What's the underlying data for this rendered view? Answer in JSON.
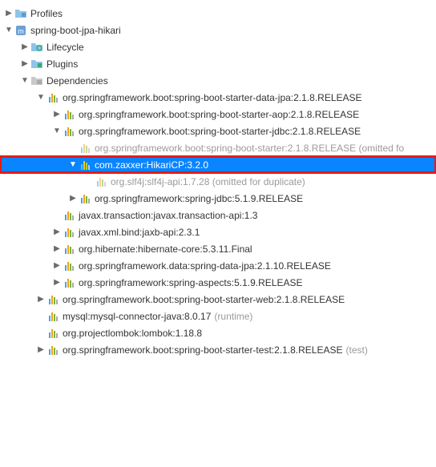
{
  "tree": [
    {
      "id": "profiles",
      "indent": 0,
      "arrow": "right",
      "icon": "folder-profiles",
      "label": "Profiles"
    },
    {
      "id": "project",
      "indent": 0,
      "arrow": "down",
      "icon": "maven",
      "label": "spring-boot-jpa-hikari"
    },
    {
      "id": "lifecycle",
      "indent": 1,
      "arrow": "right",
      "icon": "folder-lifecycle",
      "label": "Lifecycle"
    },
    {
      "id": "plugins",
      "indent": 1,
      "arrow": "right",
      "icon": "folder-plugins",
      "label": "Plugins"
    },
    {
      "id": "deps",
      "indent": 1,
      "arrow": "down",
      "icon": "folder-deps",
      "label": "Dependencies"
    },
    {
      "id": "d1",
      "indent": 2,
      "arrow": "down",
      "icon": "jar",
      "label": "org.springframework.boot:spring-boot-starter-data-jpa:2.1.8.RELEASE"
    },
    {
      "id": "d1a",
      "indent": 3,
      "arrow": "right",
      "icon": "jar",
      "label": "org.springframework.boot:spring-boot-starter-aop:2.1.8.RELEASE"
    },
    {
      "id": "d1b",
      "indent": 3,
      "arrow": "down",
      "icon": "jar",
      "label": "org.springframework.boot:spring-boot-starter-jdbc:2.1.8.RELEASE"
    },
    {
      "id": "d1b1",
      "indent": 4,
      "arrow": "none",
      "icon": "jar-dim",
      "muted": true,
      "label": "org.springframework.boot:spring-boot-starter:2.1.8.RELEASE (omitted fo"
    },
    {
      "id": "d1b2",
      "indent": 4,
      "arrow": "down",
      "icon": "jar",
      "selected": true,
      "highlighted": true,
      "label": "com.zaxxer:HikariCP:3.2.0"
    },
    {
      "id": "d1b2a",
      "indent": 5,
      "arrow": "none",
      "icon": "jar-dim",
      "muted": true,
      "label": "org.slf4j:slf4j-api:1.7.28 (omitted for duplicate)"
    },
    {
      "id": "d1b3",
      "indent": 4,
      "arrow": "right",
      "icon": "jar",
      "label": "org.springframework:spring-jdbc:5.1.9.RELEASE"
    },
    {
      "id": "d1c",
      "indent": 3,
      "arrow": "none",
      "icon": "jar",
      "label": "javax.transaction:javax.transaction-api:1.3"
    },
    {
      "id": "d1d",
      "indent": 3,
      "arrow": "right",
      "icon": "jar",
      "label": "javax.xml.bind:jaxb-api:2.3.1"
    },
    {
      "id": "d1e",
      "indent": 3,
      "arrow": "right",
      "icon": "jar",
      "label": "org.hibernate:hibernate-core:5.3.11.Final"
    },
    {
      "id": "d1f",
      "indent": 3,
      "arrow": "right",
      "icon": "jar",
      "label": "org.springframework.data:spring-data-jpa:2.1.10.RELEASE"
    },
    {
      "id": "d1g",
      "indent": 3,
      "arrow": "right",
      "icon": "jar",
      "label": "org.springframework:spring-aspects:5.1.9.RELEASE"
    },
    {
      "id": "d2",
      "indent": 2,
      "arrow": "right",
      "icon": "jar",
      "label": "org.springframework.boot:spring-boot-starter-web:2.1.8.RELEASE"
    },
    {
      "id": "d3",
      "indent": 2,
      "arrow": "none",
      "icon": "jar",
      "label": "mysql:mysql-connector-java:8.0.17",
      "scope": "(runtime)"
    },
    {
      "id": "d4",
      "indent": 2,
      "arrow": "none",
      "icon": "jar",
      "label": "org.projectlombok:lombok:1.18.8"
    },
    {
      "id": "d5",
      "indent": 2,
      "arrow": "right",
      "icon": "jar",
      "label": "org.springframework.boot:spring-boot-starter-test:2.1.8.RELEASE",
      "scope": "(test)"
    }
  ],
  "indentUnit": 20
}
